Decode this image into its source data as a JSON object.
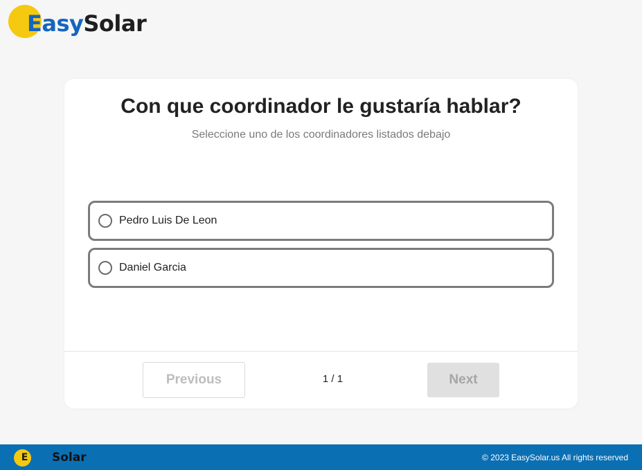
{
  "brand": {
    "name_part1": "Easy",
    "name_part2": "Solar",
    "colors": {
      "blue": "#1565c0",
      "yellow": "#f5c90f",
      "dark": "#1f1f1f"
    }
  },
  "question": {
    "title": "Con que coordinador le gustaría hablar?",
    "subtitle": "Seleccione uno de los coordinadores listados debajo",
    "options": [
      {
        "label": "Pedro Luis De Leon",
        "selected": false
      },
      {
        "label": "Daniel Garcia",
        "selected": false
      }
    ]
  },
  "navigation": {
    "previous_label": "Previous",
    "next_label": "Next",
    "page_indicator": "1 / 1"
  },
  "footer": {
    "logo_letter": "E",
    "logo_text": "Solar",
    "copyright": "© 2023 EasySolar.us All rights reserved",
    "background": "#0b6fb3"
  }
}
